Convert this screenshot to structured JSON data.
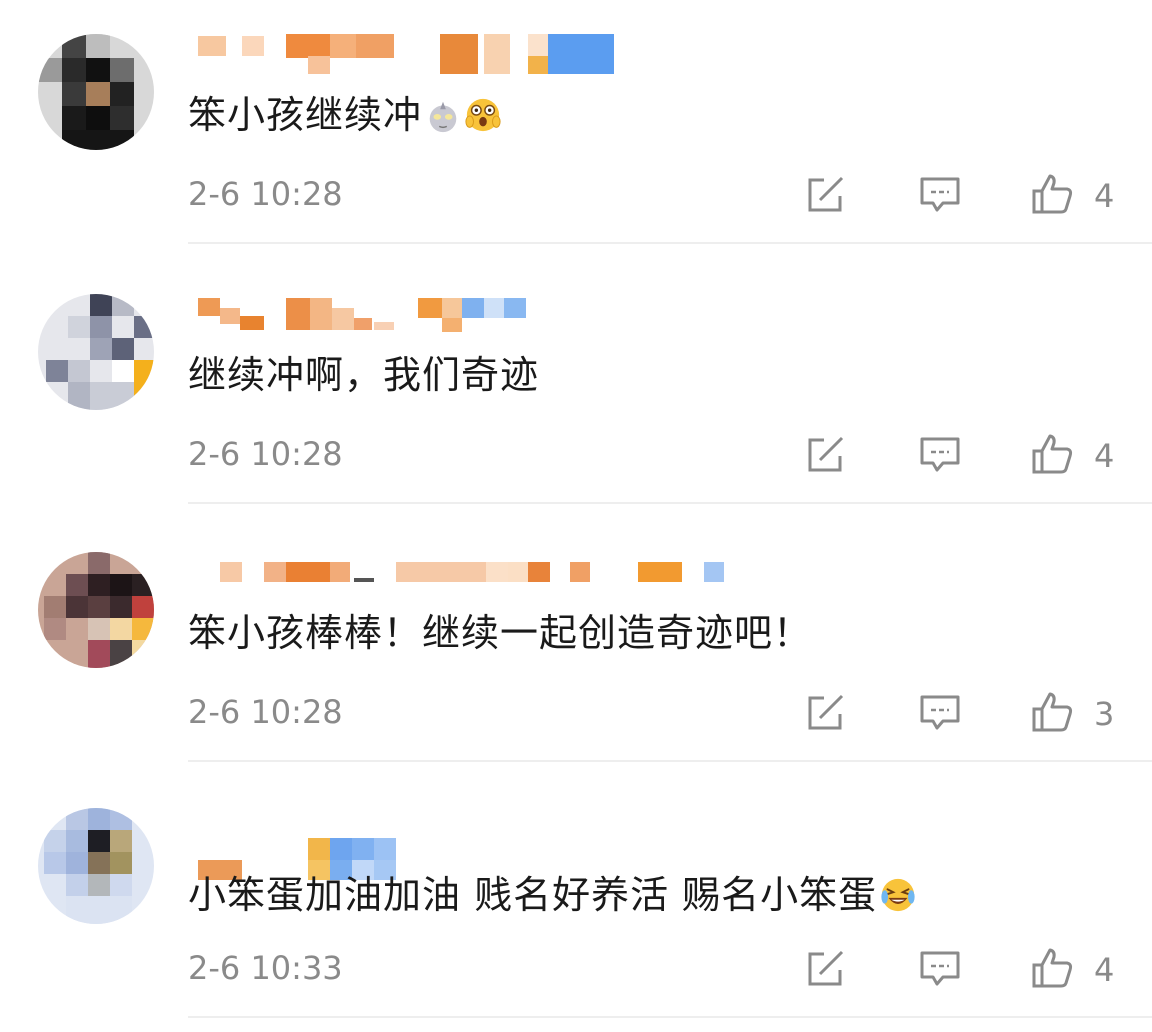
{
  "comments": [
    {
      "text": "笨小孩继续冲",
      "emojis": [
        "ultraman-emoji",
        "shocked-face-emoji"
      ],
      "time": "2-6 10:28",
      "likes": "4"
    },
    {
      "text": "继续冲啊，我们奇迹",
      "emojis": [],
      "time": "2-6 10:28",
      "likes": "4"
    },
    {
      "text": "笨小孩棒棒！继续一起创造奇迹吧！",
      "emojis": [],
      "time": "2-6 10:28",
      "likes": "3"
    },
    {
      "text": "小笨蛋加油加油 贱名好养活 赐名小笨蛋",
      "emojis": [
        "laughing-crying-face-emoji"
      ],
      "time": "2-6 10:33",
      "likes": "4"
    }
  ],
  "icons": {
    "share": "edit-share-icon",
    "reply": "comment-bubble-icon",
    "like": "thumbs-up-icon"
  },
  "colors": {
    "text": "#1a1a1a",
    "meta": "#8a8a8a",
    "divider": "#eeeeee"
  }
}
